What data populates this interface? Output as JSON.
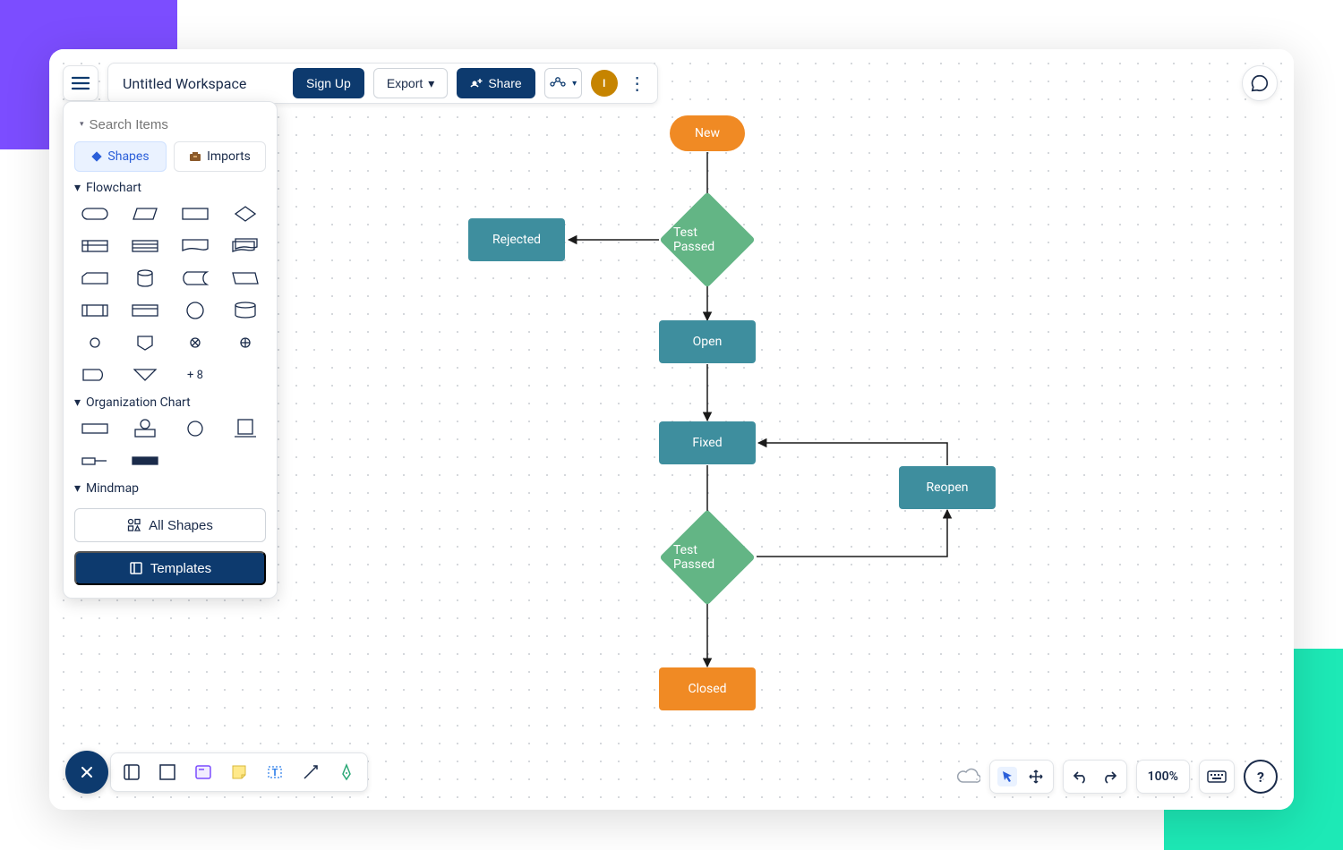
{
  "header": {
    "title": "Untitled Workspace",
    "sign_up": "Sign Up",
    "export": "Export",
    "share": "Share",
    "avatar_initial": "I"
  },
  "search": {
    "placeholder": "Search Items"
  },
  "tabs": {
    "shapes": "Shapes",
    "imports": "Imports"
  },
  "sections": {
    "flowchart": "Flowchart",
    "orgchart": "Organization Chart",
    "mindmap": "Mindmap",
    "more_count": "+ 8"
  },
  "panel_buttons": {
    "all_shapes": "All Shapes",
    "templates": "Templates"
  },
  "bottom_right": {
    "zoom": "100%"
  },
  "diagram": {
    "new": "New",
    "test_passed_1": "Test Passed",
    "rejected": "Rejected",
    "open": "Open",
    "fixed": "Fixed",
    "reopen": "Reopen",
    "test_passed_2": "Test Passed",
    "closed": "Closed"
  },
  "colors": {
    "orange": "#f08a24",
    "teal": "#3e8e9e",
    "green": "#63b585",
    "navy": "#0d3a6e"
  }
}
